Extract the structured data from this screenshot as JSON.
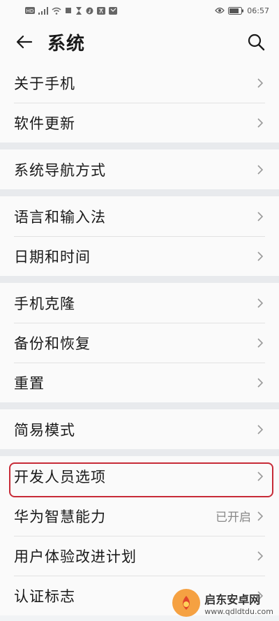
{
  "status_bar": {
    "time": "06:57"
  },
  "header": {
    "title": "系统"
  },
  "groups": [
    {
      "items": [
        {
          "label": "关于手机"
        },
        {
          "label": "软件更新"
        }
      ]
    },
    {
      "items": [
        {
          "label": "系统导航方式"
        }
      ]
    },
    {
      "items": [
        {
          "label": "语言和输入法"
        },
        {
          "label": "日期和时间"
        }
      ]
    },
    {
      "items": [
        {
          "label": "手机克隆"
        },
        {
          "label": "备份和恢复"
        },
        {
          "label": "重置"
        }
      ]
    },
    {
      "items": [
        {
          "label": "简易模式"
        }
      ]
    },
    {
      "items": [
        {
          "label": "开发人员选项"
        },
        {
          "label": "华为智慧能力",
          "value": "已开启"
        },
        {
          "label": "用户体验改进计划"
        },
        {
          "label": "认证标志"
        }
      ]
    }
  ],
  "watermark": {
    "name": "启东安卓网",
    "url": "www.qdldtdu.com"
  },
  "colors": {
    "highlight": "#c72b37",
    "background": "#f1f3f5"
  }
}
